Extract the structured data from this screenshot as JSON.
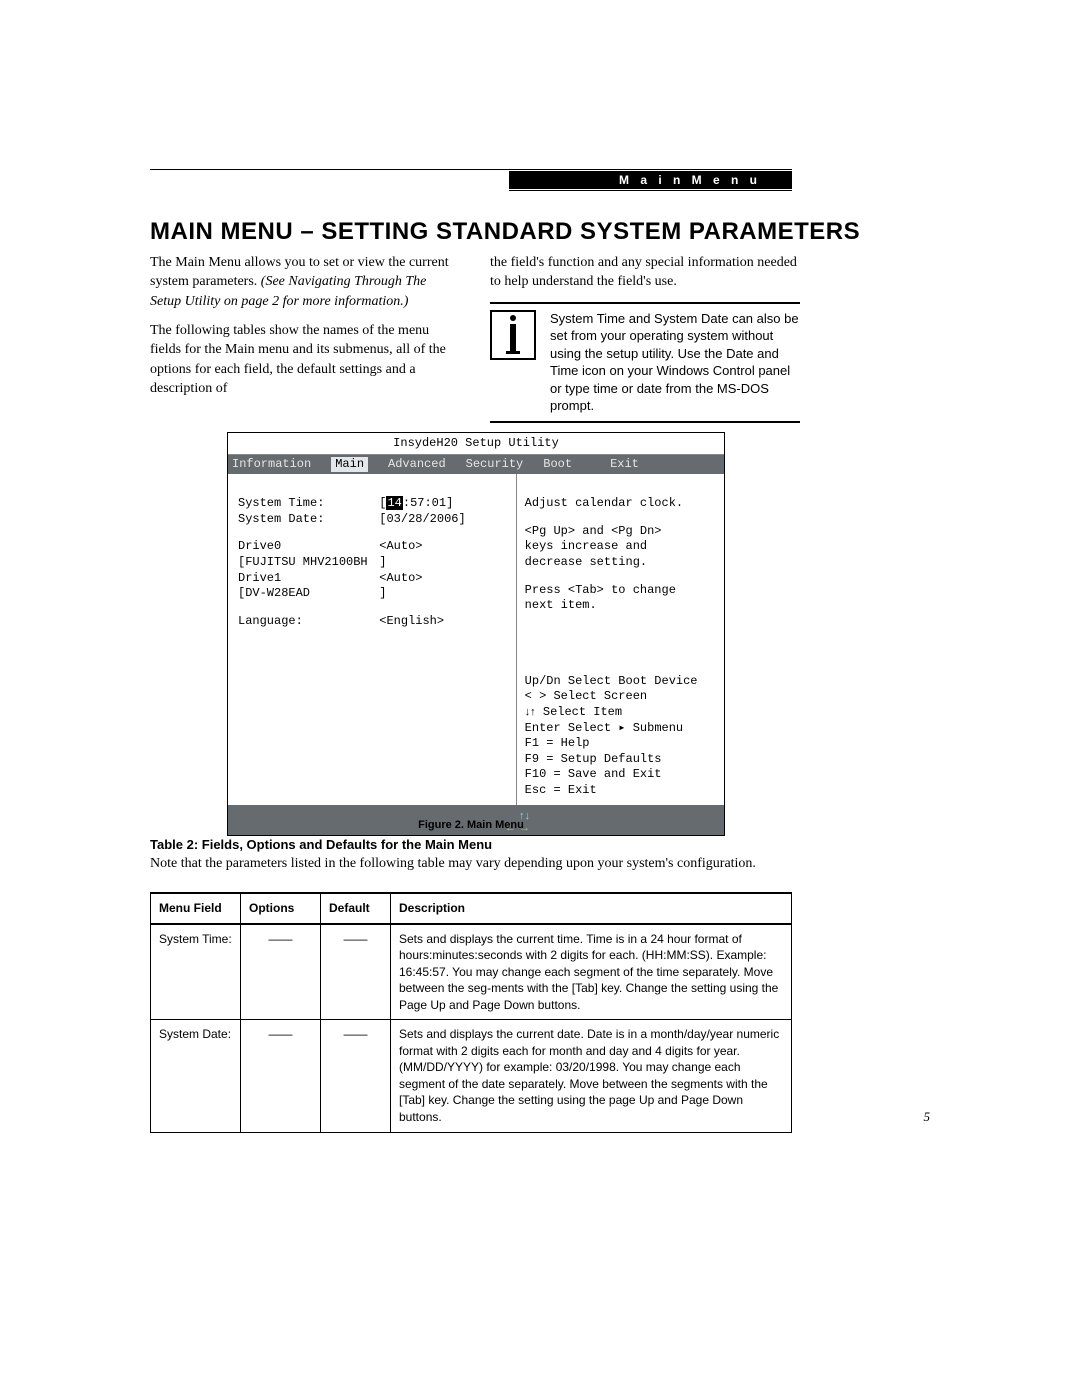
{
  "header": {
    "label": "M a i n   M e n u"
  },
  "page_title": "MAIN MENU – SETTING STANDARD SYSTEM PARAMETERS",
  "intro": {
    "p1a": "The Main Menu allows you to set or view the current system parameters. ",
    "p1b": "(See Navigating Through The Setup Utility on page 2 for more information.)",
    "p2": "The following tables show the names of the menu fields for the Main menu and its submenus, all of the options for each field, the default settings and a description of",
    "p3": "the field's function and any special information needed to help understand the field's use.",
    "info_note": "System Time and System Date can also be set from your operating system without using the setup utility. Use the Date and Time icon on your Windows Control panel or type time or date from the MS-DOS prompt."
  },
  "bios": {
    "title": "InsydeH20 Setup Utility",
    "tabs": [
      "Information",
      "Main",
      "Advanced",
      "Security",
      "Boot",
      "Exit"
    ],
    "active_tab_index": 1,
    "fields": {
      "system_time": {
        "label": "System Time:",
        "value_pre": "[",
        "value_hl": "14",
        "value_post": ":57:01]"
      },
      "system_date": {
        "label": "System Date:",
        "value": "[03/28/2006]"
      },
      "drive0": {
        "label": "Drive0",
        "value": "<Auto>"
      },
      "drive0_id": {
        "label": "[FUJITSU MHV2100BH",
        "value": "]"
      },
      "drive1": {
        "label": "Drive1",
        "value": "<Auto>"
      },
      "drive1_id": {
        "label": "[DV-W28EAD",
        "value": "]"
      },
      "language": {
        "label": "Language:",
        "value": "<English>"
      }
    },
    "help": {
      "l1": "Adjust calendar clock.",
      "l2": "<Pg Up> and <Pg Dn>",
      "l3": "keys increase and",
      "l4": "decrease setting.",
      "l5": "Press <Tab> to change",
      "l6": "next item."
    },
    "nav": {
      "n1": "Up/Dn Select Boot Device",
      "n2": "< >   Select Screen",
      "n3_arrows": "↓↑",
      "n3": "    Select Item",
      "n4": "Enter Select ▸ Submenu",
      "n5": "F1  = Help",
      "n6": "F9  = Setup Defaults",
      "n7": "F10 = Save and Exit",
      "n8": "Esc = Exit"
    }
  },
  "figure_caption": "Figure 2.   Main Menu",
  "table_title": "Table 2: Fields, Options and Defaults for the Main Menu",
  "table_note": "Note that the parameters listed in the following table may vary depending upon your system's configuration.",
  "table": {
    "headers": [
      "Menu Field",
      "Options",
      "Default",
      "Description"
    ],
    "rows": [
      {
        "menu_field": "System Time:",
        "options": "——",
        "default": "——",
        "description": "Sets and displays the current time. Time is in a 24 hour format of hours:minutes:seconds with 2 digits for each. (HH:MM:SS). Example: 16:45:57. You may change each segment of the time separately. Move between the seg-ments with the [Tab] key. Change the setting using the Page Up and Page Down buttons."
      },
      {
        "menu_field": "System Date:",
        "options": "——",
        "default": "——",
        "description": "Sets and displays the current date. Date is in a month/day/year numeric format with 2 digits each for month and day and 4 digits for year. (MM/DD/YYYY) for example: 03/20/1998. You may change each segment of the date separately. Move between the segments with the [Tab] key. Change the setting using the page Up and Page Down buttons."
      }
    ]
  },
  "page_number": "5"
}
